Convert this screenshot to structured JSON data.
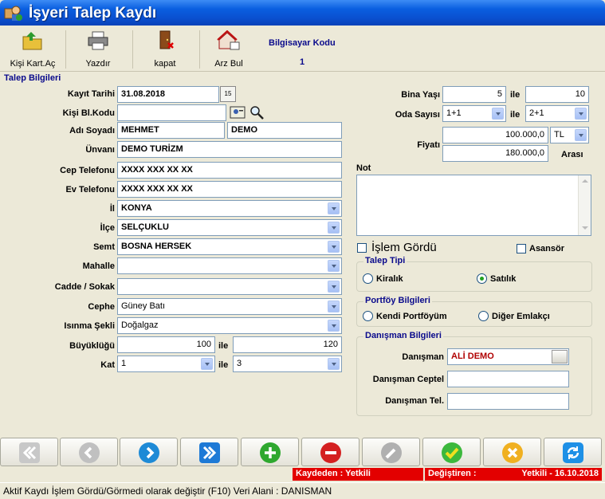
{
  "window": {
    "title": "İşyeri Talep Kaydı"
  },
  "toolbar": {
    "open_card": "Kişi Kart.Aç",
    "print": "Yazdır",
    "close": "kapat",
    "find_offer": "Arz Bul",
    "computer_code_label": "Bilgisayar Kodu",
    "computer_code_value": "1"
  },
  "form": {
    "section_title": "Talep Bilgileri",
    "record_date_label": "Kayıt Tarihi",
    "record_date": "31.08.2018",
    "calendar_btn": "15",
    "person_code_label": "Kişi Bl.Kodu",
    "person_code": "",
    "name_label": "Adı Soyadı",
    "first_name": "MEHMET",
    "last_name": "DEMO",
    "title_label": "Ünvanı",
    "title_value": "DEMO TURİZM",
    "mobile_label": "Cep Telefonu",
    "mobile": "XXXX XXX XX XX",
    "home_phone_label": "Ev Telefonu",
    "home_phone": "XXXX XXX XX XX",
    "city_label": "İl",
    "city": "KONYA",
    "district_label": "İlçe",
    "district": "SELÇUKLU",
    "area_label": "Semt",
    "area": "BOSNA HERSEK",
    "neighborhood_label": "Mahalle",
    "neighborhood": "",
    "street_label": "Cadde / Sokak",
    "street": "",
    "facade_label": "Cephe",
    "facade": "Güney Batı",
    "heating_label": "Isınma Şekli",
    "heating": "Doğalgaz",
    "size_label": "Büyüklüğü",
    "size_from": "100",
    "size_to": "120",
    "floor_label": "Kat",
    "floor_from": "1",
    "floor_to": "3",
    "range_word": "ile",
    "building_age_label": "Bina Yaşı",
    "building_age_from": "5",
    "building_age_to": "10",
    "rooms_label": "Oda Sayısı",
    "rooms_from": "1+1",
    "rooms_to": "2+1",
    "price_label": "Fiyatı",
    "price_from": "100.000,0",
    "price_currency": "TL",
    "price_to": "180.000,0",
    "price_between": "Arası",
    "note_label": "Not",
    "note": "",
    "processed_label": "İşlem Gördü",
    "elevator_label": "Asansör"
  },
  "request_type": {
    "title": "Talep Tipi",
    "rent": "Kiralık",
    "sale": "Satılık",
    "selected": "sale"
  },
  "portfolio": {
    "title": "Portföy Bilgileri",
    "own": "Kendi Portföyüm",
    "other": "Diğer Emlakçı"
  },
  "consultant": {
    "title": "Danışman Bilgileri",
    "name_label": "Danışman",
    "name": "ALİ DEMO",
    "mobile_label": "Danışman Ceptel",
    "mobile": "",
    "phone_label": "Danışman Tel.",
    "phone": ""
  },
  "status": {
    "saved_by": "Kaydeden : Yetkili",
    "changed_by_label": "Değiştiren :",
    "changed_by": "Yetkili - 16.10.2018"
  },
  "bottom_hint": "Aktif Kaydı İşlem Gördü/Görmedi olarak değiştir (F10) Veri Alani : DANISMAN",
  "colors": {
    "title_blue": "#0a5fe0",
    "status_red": "#e30000",
    "header_navy": "#0a0a8c",
    "consultant_red": "#b00000"
  }
}
